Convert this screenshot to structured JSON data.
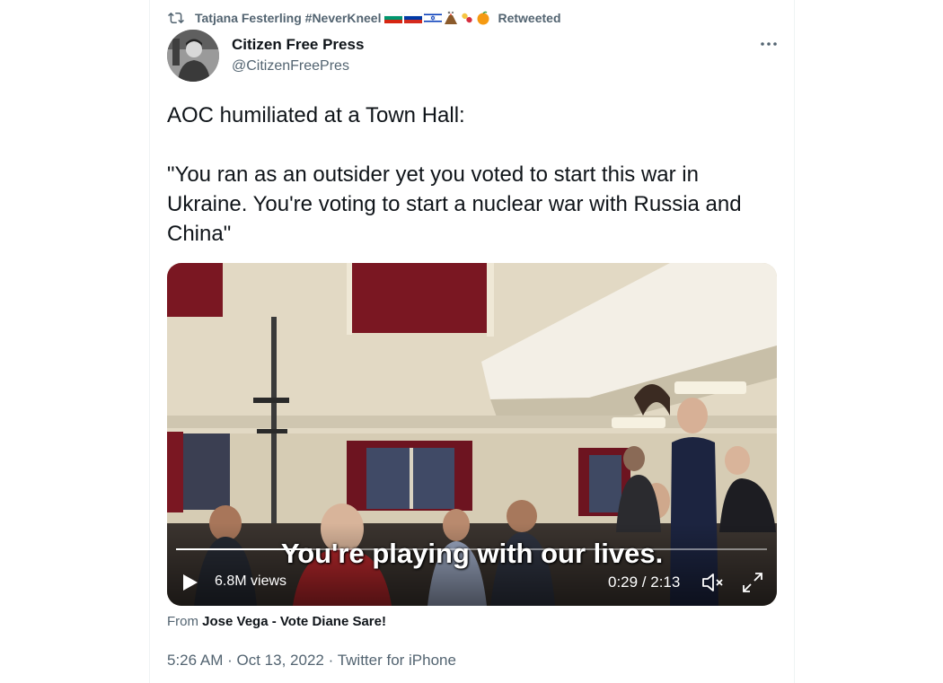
{
  "retweet": {
    "name": "Tatjana Festerling #NeverKneel",
    "suffix": "Retweeted",
    "icon": "retweet-icon",
    "emojis": [
      "bulgaria-flag",
      "russia-flag",
      "israel-flag",
      "volcano-emoji",
      "pill-emoji",
      "orange-emoji"
    ]
  },
  "author": {
    "name": "Citizen Free Press",
    "handle": "@CitizenFreePres"
  },
  "tweet": {
    "text": "AOC humiliated at a Town Hall:\n\n\"You ran as an outsider yet you voted to start this war in Ukraine. You're voting to start a nuclear war with Russia and China\""
  },
  "video": {
    "subtitle": "You're playing with our lives.",
    "views": "6.8M views",
    "time": "0:29 / 2:13",
    "progress": 0.23
  },
  "source": {
    "prefix": "From",
    "name": "Jose Vega - Vote Diane Sare!"
  },
  "meta": {
    "time": "5:26 AM",
    "separator1": "·",
    "date": "Oct 13, 2022",
    "separator2": "·",
    "client": "Twitter for iPhone"
  },
  "colors": {
    "primary_text": "#0f1419",
    "secondary_text": "#536471",
    "border": "#eff3f4"
  }
}
